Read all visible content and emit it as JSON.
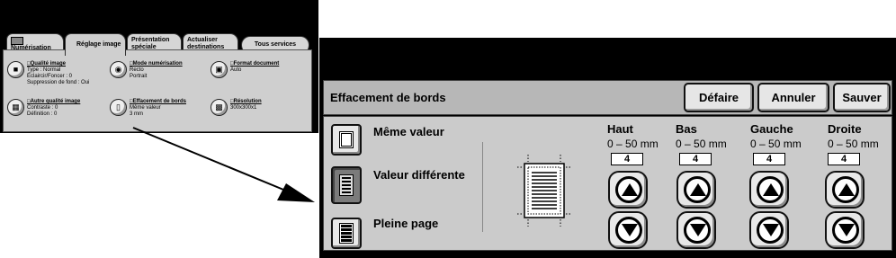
{
  "small_panel": {
    "tabs": [
      {
        "label": "Numérisation réseau",
        "active": false
      },
      {
        "label": "Réglage image",
        "active": true
      },
      {
        "label": "Présentation spéciale",
        "active": false
      },
      {
        "label": "Actualiser destinations",
        "active": false
      },
      {
        "label": "Tous services",
        "active": false
      }
    ],
    "items": [
      {
        "title": "Qualité image",
        "lines": [
          "Type : Normal",
          "Éclaircir/Foncer : 0",
          "Suppression de fond : Oui"
        ],
        "icon": "image-quality-icon"
      },
      {
        "title": "Mode numérisation",
        "lines": [
          "Recto",
          "Portrait"
        ],
        "icon": "scan-mode-icon"
      },
      {
        "title": "Format document",
        "lines": [
          "Auto"
        ],
        "icon": "document-size-icon"
      },
      {
        "title": "Autre qualité image",
        "lines": [
          "Contraste : 0",
          "Définition : 0"
        ],
        "icon": "image-options-icon"
      },
      {
        "title": "Effacement de bords",
        "lines": [
          "Même valeur",
          "3 mm"
        ],
        "icon": "edge-erase-icon"
      },
      {
        "title": "Résolution",
        "lines": [
          "300x300x1"
        ],
        "icon": "resolution-icon"
      }
    ]
  },
  "main_panel": {
    "title": "Effacement de bords",
    "buttons": {
      "undo": "Défaire",
      "cancel": "Annuler",
      "save": "Sauver"
    },
    "options": [
      {
        "label": "Même valeur",
        "selected": false
      },
      {
        "label": "Valeur différente",
        "selected": true
      },
      {
        "label": "Pleine page",
        "selected": false
      }
    ],
    "edges": [
      {
        "name": "Haut",
        "range": "0 – 50 mm",
        "value": "4"
      },
      {
        "name": "Bas",
        "range": "0 – 50 mm",
        "value": "4"
      },
      {
        "name": "Gauche",
        "range": "0 – 50 mm",
        "value": "4"
      },
      {
        "name": "Droite",
        "range": "0 – 50 mm",
        "value": "4"
      }
    ]
  },
  "colors": {
    "panel_bg": "#cbcbcb",
    "header_bg": "#b7b7b7",
    "frame": "#000000",
    "selected": "#7b7b7b"
  }
}
